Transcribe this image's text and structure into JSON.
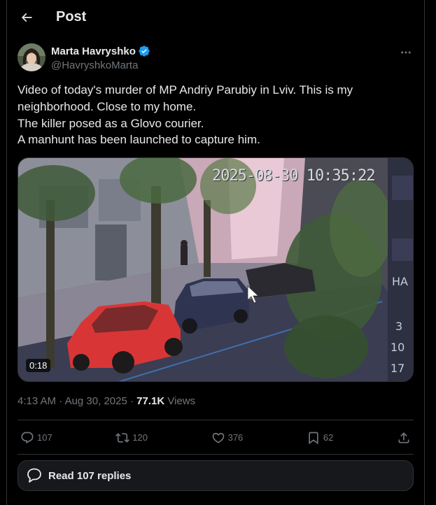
{
  "header": {
    "title": "Post",
    "back_icon": "arrow-left-icon"
  },
  "author": {
    "name": "Marta Havryshko",
    "handle": "@HavryshkoMarta",
    "verified": true,
    "verified_color": "#1d9bf0"
  },
  "post": {
    "lines": [
      "Video of today's murder of MP Andriy Parubiy in Lviv. This is my neighborhood. Close to my home.",
      "The killer posed as a Glovo courier.",
      "A manhunt has been launched to capture him."
    ]
  },
  "media": {
    "type": "video",
    "overlay_timestamp": "2025-08-30 10:35:22",
    "duration": "0:18",
    "side_text": [
      "НА",
      "3",
      "10",
      "17"
    ]
  },
  "meta": {
    "time": "4:13 AM",
    "separator": "·",
    "date": "Aug 30, 2025",
    "dot": "·",
    "views_count": "77.1K",
    "views_label": "Views"
  },
  "actions": {
    "replies": "107",
    "reposts": "120",
    "likes": "376",
    "bookmarks": "62"
  },
  "read_replies": {
    "label": "Read 107 replies"
  },
  "colors": {
    "background": "#000000",
    "text": "#e7e9ea",
    "muted": "#71767b",
    "border": "#2f3336",
    "accent": "#1d9bf0"
  }
}
